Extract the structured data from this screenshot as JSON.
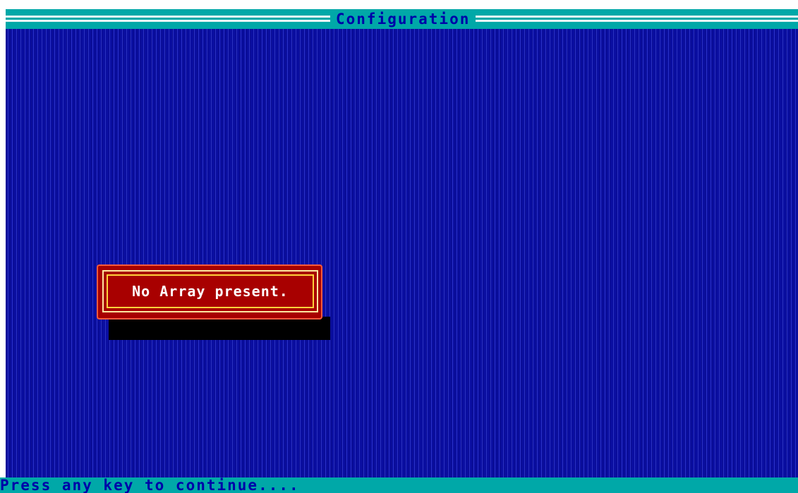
{
  "window": {
    "title": "Configuration"
  },
  "dialog": {
    "message": "No Array present."
  },
  "status_bar": {
    "prompt": "Press any key to continue...."
  },
  "colors": {
    "desktop_blue": "#0a0ea0",
    "bar_cyan": "#00a8a8",
    "text_blue": "#0000a8",
    "dialog_red": "#a80000",
    "dialog_border_yellow": "#ffd23c",
    "dialog_text": "#ffffff",
    "shadow": "#000000"
  }
}
